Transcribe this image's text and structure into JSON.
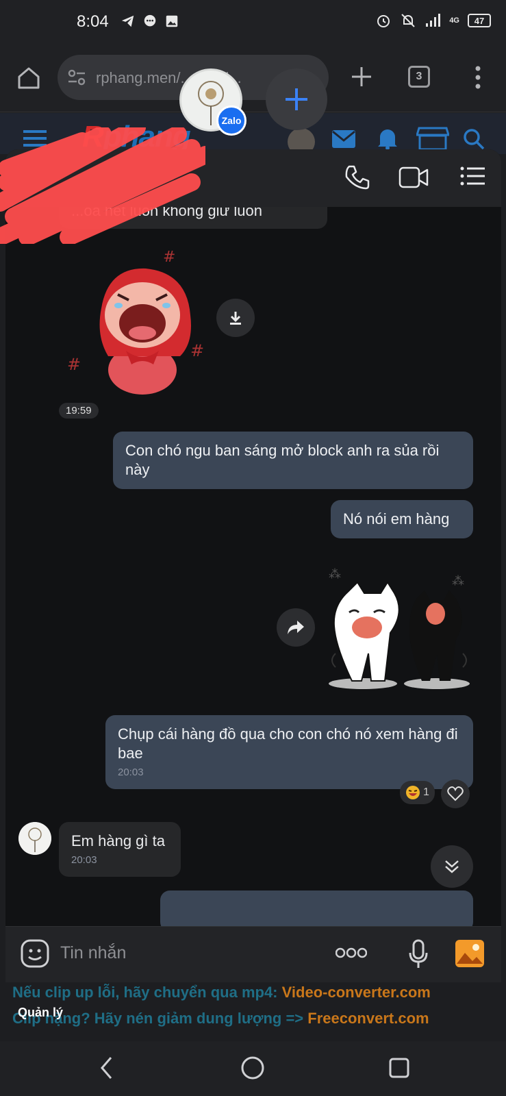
{
  "status_bar": {
    "time": "8:04",
    "battery": "47",
    "network": "4G"
  },
  "browser": {
    "url": "rphang.men/...vien-l...",
    "tab_count": "3"
  },
  "chat": {
    "messages": [
      {
        "side": "in",
        "text": "...óa hết luôn không giữ luôn"
      },
      {
        "side": "in",
        "type": "sticker",
        "time": "19:59"
      },
      {
        "side": "out",
        "text": "Con chó ngu ban sáng mở block anh ra sủa rồi này"
      },
      {
        "side": "out",
        "text": "Nó nói em hàng"
      },
      {
        "side": "out",
        "type": "sticker"
      },
      {
        "side": "out",
        "text": "Chụp cái hàng đồ qua cho con chó nó xem hàng đi bae",
        "time": "20:03",
        "reaction_count": "1"
      },
      {
        "side": "in",
        "text": "Em hàng gì ta",
        "time": "20:03"
      }
    ]
  },
  "composer": {
    "placeholder": "Tin nhắn"
  },
  "zalo_badge": "Zalo",
  "site_banner": {
    "line1_text": "Nếu clip up lỗi, hãy chuyển qua mp4: ",
    "line1_link": "Video-converter.com",
    "line2_text": "Clip nặng? Hãy nén giảm dung lượng => ",
    "line2_link": "Freeconvert.com",
    "manage_label": "Quản lý"
  },
  "colors": {
    "bubble_out": "#3b4656",
    "bubble_in": "#262729",
    "accent": "#1a6ef0",
    "link_orange": "#c9771a"
  }
}
